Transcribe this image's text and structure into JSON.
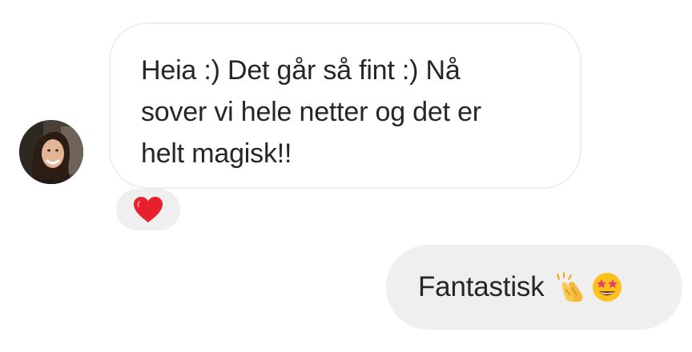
{
  "conversation": {
    "incoming": {
      "avatar_icon": "user-avatar-photo",
      "text": "Heia :) Det går så fint :) Nå\nsover vi hele netter og det er\nhelt magisk!!",
      "reaction": {
        "icon": "red-heart-icon",
        "color": "#e8202e"
      },
      "bubble_border_color": "#efefef"
    },
    "outgoing": {
      "text": "Fantastisk",
      "emojis": [
        "clapping-hands-icon",
        "star-struck-icon"
      ],
      "bubble_color": "#efefef"
    }
  }
}
